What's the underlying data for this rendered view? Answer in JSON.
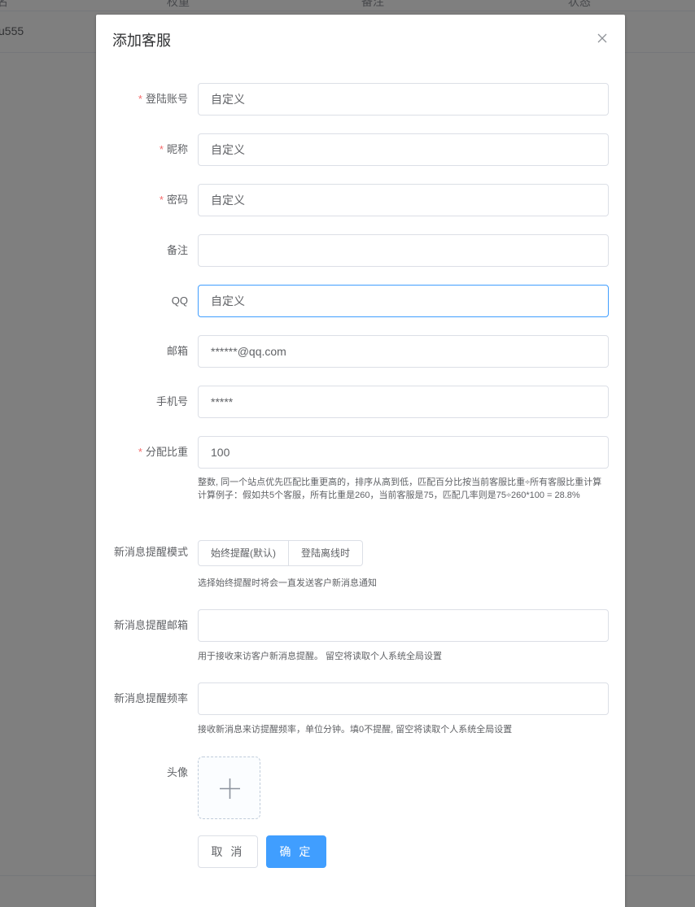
{
  "background": {
    "headers": [
      "名",
      "权重",
      "备注",
      "状态"
    ],
    "row_first_cell": "u555"
  },
  "dialog": {
    "title": "添加客服",
    "close_icon": "close-icon"
  },
  "form": {
    "login_account": {
      "label": "登陆账号",
      "required": "*",
      "value": "自定义"
    },
    "nickname": {
      "label": "昵称",
      "required": "*",
      "value": "自定义"
    },
    "password": {
      "label": "密码",
      "required": "*",
      "value": "自定义"
    },
    "remark": {
      "label": "备注",
      "value": ""
    },
    "qq": {
      "label": "QQ",
      "value": "自定义"
    },
    "email": {
      "label": "邮箱",
      "value": "******@qq.com"
    },
    "phone": {
      "label": "手机号",
      "value": "*****"
    },
    "weight": {
      "label": "分配比重",
      "required": "*",
      "value": "100",
      "help_line1": "整数, 同一个站点优先匹配比重更高的，排序从高到低，匹配百分比按当前客服比重÷所有客服比重计算",
      "help_line2": "计算例子：假如共5个客服，所有比重是260，当前客服是75，匹配几率则是75÷260*100 = 28.8%"
    },
    "notify_mode": {
      "label": "新消息提醒模式",
      "options": [
        "始终提醒(默认)",
        "登陆离线时"
      ],
      "help": "选择始终提醒时将会一直发送客户新消息通知"
    },
    "notify_email": {
      "label": "新消息提醒邮箱",
      "value": "",
      "help": "用于接收来访客户新消息提醒。 留空将读取个人系统全局设置"
    },
    "notify_frequency": {
      "label": "新消息提醒频率",
      "value": "",
      "help": "接收新消息来访提醒频率，单位分钟。填0不提醒, 留空将读取个人系统全局设置"
    },
    "avatar": {
      "label": "头像",
      "icon": "plus-icon"
    }
  },
  "buttons": {
    "cancel": "取 消",
    "confirm": "确 定"
  },
  "colors": {
    "primary": "#409eff",
    "required": "#f56c6c",
    "border": "#dcdfe6"
  }
}
